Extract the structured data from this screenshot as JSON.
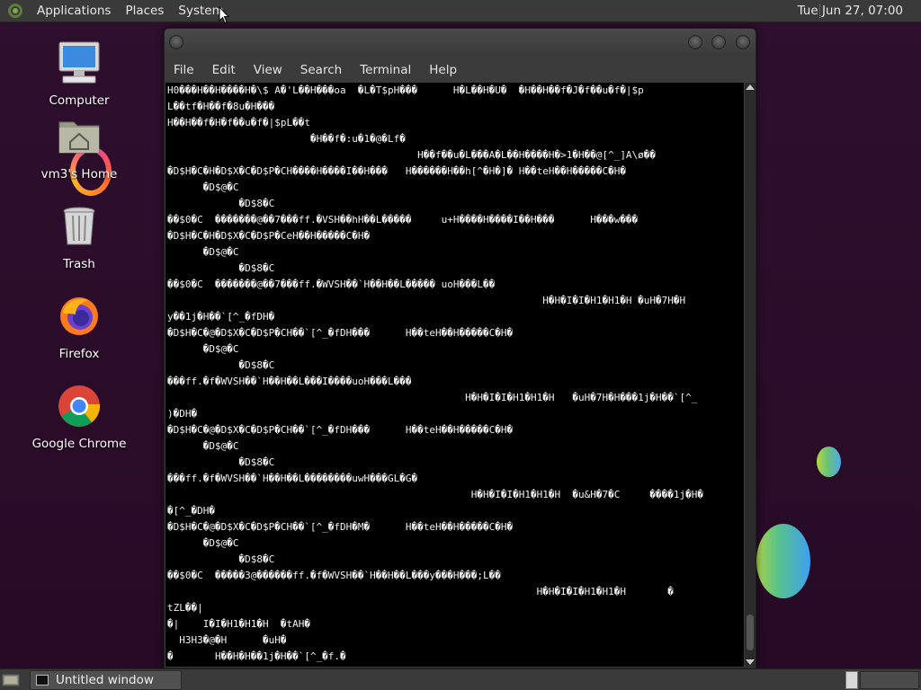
{
  "top_panel": {
    "menus": [
      "Applications",
      "Places",
      "System"
    ],
    "clock": "Tue Jun 27, 07:00"
  },
  "desktop": {
    "icons": [
      {
        "label": "Computer",
        "icon": "computer-icon"
      },
      {
        "label": "vm3's Home",
        "icon": "home-folder-icon"
      },
      {
        "label": "Trash",
        "icon": "trash-icon"
      },
      {
        "label": "Firefox",
        "icon": "firefox-icon"
      },
      {
        "label": "Google Chrome",
        "icon": "chrome-icon"
      }
    ]
  },
  "terminal": {
    "menu": [
      "File",
      "Edit",
      "View",
      "Search",
      "Terminal",
      "Help"
    ],
    "lines": [
      "H0���H��H����H�\\$ A�'L��H���oa  �L�T$pH���      H�L��H�U�  �H��H��f�J�f��u�f�|$p",
      "L��tf�H��f�8u�H���",
      "H��H��f�H�f��u�f�|$pL��t",
      "                        �H��f�:u�1�@�Lf�",
      "                                          H��f��u�L���A�L��H����H�>1�H��@[^_]A\\ø��",
      "�D$H�C�H�D$X�C�D$P�CH����H����I��H���   H������H��h[^�H�]� H��teH��H�����C�H�",
      "      �D$@�C",
      "            �D$8�C",
      "��$0�C  �������@��7���ff.�VSH��hH��L�����     u+H����H����I��H���      H���w���",
      "�D$H�C�H�D$X�C�D$P�CeH��H�����C�H�",
      "      �D$@�C",
      "            �D$8�C",
      "��$0�C  �������@��7���ff.�WVSH��`H��H��L����� uoH���L��",
      "                                                               H�H�I�I�H1�H1�H �uH�7H�H",
      "y��1j�H��`[^_�fDH�",
      "�D$H�C�@�D$X�C�D$P�CH��`[^_�fDH���      H��teH��H�����C�H�",
      "      �D$@�C",
      "            �D$8�C",
      "���ff.�f�WVSH��`H��H��L���I����uoH���L���",
      "                                                  H�H�I�I�H1�H1�H   �uH�7H�H���1j�H��`[^_",
      ")�DH�",
      "�D$H�C�@�D$X�C�D$P�CH��`[^_�fDH���      H��teH��H�����C�H�",
      "      �D$@�C",
      "            �D$8�C",
      "���ff.�f�WVSH��`H��H��L��������uwH���GL�G�",
      "                                                   H�H�I�I�H1�H1�H  �u&H�7�C     ����1j�H�",
      "�[^_�DH�",
      "�D$H�C�@�D$X�C�D$P�CH��`[^_�fDH�M�      H��teH��H�����C�H�",
      "      �D$@�C",
      "            �D$8�C",
      "��$0�C  �����3@������ff.�f�WVSH��`H��H��L���y���H���;L��",
      "                                                              H�H�I�I�H1�H1�H       �",
      "tZL��|",
      "�|    I�I�H1�H1�H  �tAH�",
      "  H3H3�@�H      �uH�",
      "�       H��H�H��1j�H��`[^_�f.�"
    ]
  },
  "taskbar": {
    "window_title": "Untitled window"
  }
}
